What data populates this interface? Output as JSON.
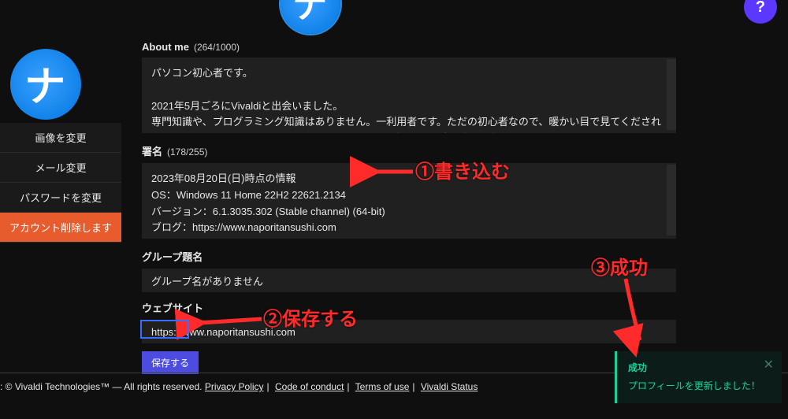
{
  "header": {
    "avatar_glyph": "ナ",
    "help_label": "?"
  },
  "sidebar": {
    "avatar_glyph": "ナ",
    "items": [
      {
        "label": "画像を変更"
      },
      {
        "label": "メール変更"
      },
      {
        "label": "パスワードを変更"
      },
      {
        "label": "アカウント削除します"
      }
    ]
  },
  "sections": {
    "about": {
      "title": "About me",
      "counter": "(264/1000)",
      "value": "パソコン初心者です。\n\n2021年5月ごろにVivaldiと出会いました。\n専門知識や、プログラミング知識はありません。一利用者です。ただの初心者なので、暖かい目で見てくださればなと思います。パソコンのフリーソフトやVivaldiを紹介するブログを運営しています。"
    },
    "signature": {
      "title": "署名",
      "counter": "(178/255)",
      "value": "2023年08月20日(日)時点の情報\nOS：Windows 11 Home 22H2 22621.2134\nバージョン：6.1.3035.302 (Stable channel) (64-bit)\nブログ：https://www.naporitansushi.com\nTwitter：https://twitter.com/Naporitansushi"
    },
    "group": {
      "title": "グループ題名",
      "value": "グループ名がありません"
    },
    "website": {
      "title": "ウェブサイト",
      "value": "https://www.naporitansushi.com"
    },
    "save_label": "保存する"
  },
  "footer": {
    "prefix": ": © Vivaldi Technologies™ — All rights reserved. ",
    "links": [
      "Privacy Policy",
      "Code of conduct",
      "Terms of use",
      "Vivaldi Status"
    ]
  },
  "toast": {
    "title": "成功",
    "message": "プロフィールを更新しました！",
    "close": "✕"
  },
  "annotations": {
    "a1": "①書き込む",
    "a2": "②保存する",
    "a3": "③成功"
  }
}
